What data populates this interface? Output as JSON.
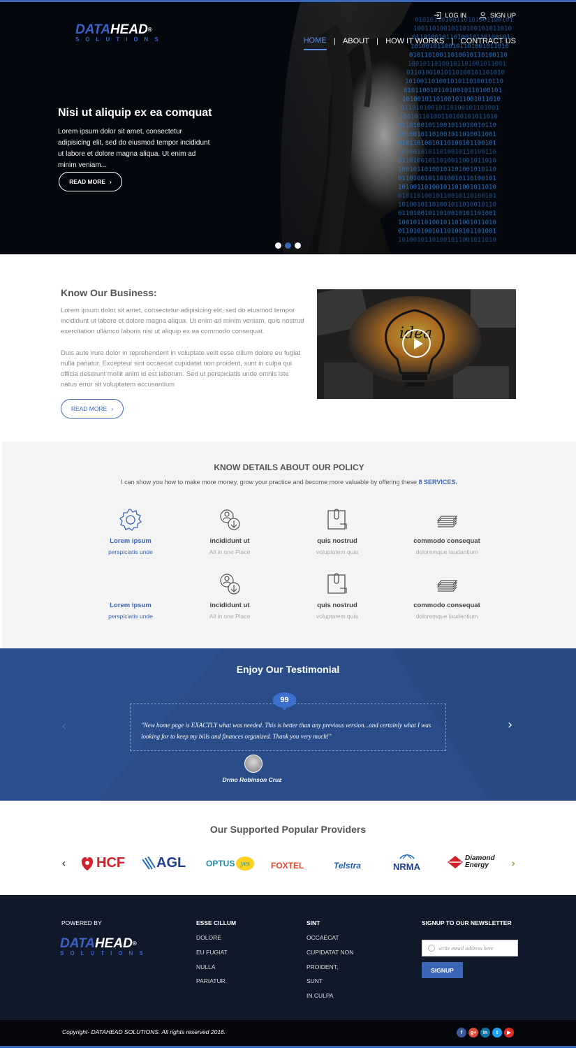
{
  "header": {
    "logo": {
      "main_a": "DATA",
      "main_b": "HEAD",
      "reg": "®",
      "sub": "SOLUTIONS"
    },
    "auth": {
      "login": "LOG IN",
      "signup": "SIGN UP"
    },
    "nav": [
      {
        "label": "HOME",
        "active": true
      },
      {
        "label": "ABOUT",
        "active": false
      },
      {
        "label": "HOW IT WORKS",
        "active": false
      },
      {
        "label": "CONTRACT US",
        "active": false
      }
    ]
  },
  "hero": {
    "title": "Nisi ut aliquip ex ea comquat",
    "text": "Lorem ipsum dolor sit amet, consectetur adipisicing elit, sed do eiusmod tempor incididunt ut labore et dolore magna aliqua. Ut enim ad minim veniam...",
    "button": "READ MORE",
    "binary_rows": [
      "01010110100110101001100101",
      "10011010010110100101011010",
      "01101001011010010110100101",
      "10100101100101101001011010",
      "01011010011010010110100110",
      "10010110100101101001011001",
      "01101001010110100101101010",
      "10100110100101011010010110",
      "01011001011010010110100101",
      "10100101101001011001011010",
      "01101010010110100101101001",
      "10010110100110100101011010",
      "01101001011001011010010110",
      "10100101101001011010011001",
      "01011010010110100101100101",
      "10100101011010010110100110",
      "01101001011010011001011010",
      "10010110100101101001010110",
      "01101001011010010110100101",
      "10100110100101101001011010",
      "01011010010110010110100101",
      "10100101101001011010010110",
      "01101001011010010101101001",
      "10010110100101101001011010",
      "01101010010110100101101001",
      "10100101101001011001011010"
    ],
    "slides": 3,
    "active_slide": 1
  },
  "business": {
    "title": "Know Our Business:",
    "p1": "Lorem ipsum dolor sit amet, consectetur adipisicing elit, sed do eiusmod tempor incididunt ut labore et dolore magna aliqua. Ut enim ad minim veniam, quis nostrud exercitation ullamco laboris nisi ut aliquip ex ea commodo consequat.",
    "p2": "Duis aute irure dolor in reprehenderit in voluptate velit esse cillum dolore eu fugiat nulla pariatur. Excepteur sint occaecat cupidatat non proident, sunt in culpa qui officia deserunt mollit anim id est laborum. Sed ut perspiciatis unde omnis iste natus error sit voluptatem accusantium",
    "button": "READ MORE",
    "video_word": "idea"
  },
  "policy": {
    "title": "KNOW DETAILS ABOUT OUR POLICY",
    "subtitle": "I can show you how to make more money, grow your practice and become more valuable by offering these",
    "subtitle_highlight": "8 SERVICES.",
    "services": [
      {
        "icon": "gear-icon",
        "title": "Lorem ipsum",
        "sub": "perspiciatis unde",
        "highlight": true
      },
      {
        "icon": "user-download-icon",
        "title": "incididunt ut",
        "sub": "All in one Place",
        "highlight": false
      },
      {
        "icon": "clipboard-icon",
        "title": "quis nostrud",
        "sub": "voluptatem quia",
        "highlight": false
      },
      {
        "icon": "stack-icon",
        "title": "commodo consequat",
        "sub": "doloremque laudantium",
        "highlight": false
      },
      {
        "icon": "",
        "title": "Lorem ipsum",
        "sub": "perspiciatis unde",
        "highlight": true
      },
      {
        "icon": "user-download-icon",
        "title": "incididunt ut",
        "sub": "All in one Place",
        "highlight": false
      },
      {
        "icon": "clipboard-icon",
        "title": "quis nostrud",
        "sub": "voluptatem quia",
        "highlight": false
      },
      {
        "icon": "stack-icon",
        "title": "commodo consequat",
        "sub": "doloremque laudantium",
        "highlight": false
      }
    ]
  },
  "testimonial": {
    "title": "Enjoy Our  Testimonial",
    "badge": "99",
    "quote": "\"New home page is EXACTLY what was needed. This is better than any previous version...and certainly what I was looking for to keep my bills and finances organized. Thank you very much!\"",
    "author": "Drmo Robinson Cruz",
    "prev": "‹",
    "next": "›"
  },
  "providers": {
    "title": "Our Supported Popular Providers",
    "prev": "‹",
    "next": "›",
    "brands": [
      {
        "name": "HCF",
        "color": "#d4202c"
      },
      {
        "name": "AGL",
        "color": "#1f3f8c"
      },
      {
        "name": "OPTUS",
        "color": "#1a8ea8",
        "extra": "yes"
      },
      {
        "name": "FOXTEL",
        "color": "#e9452a"
      },
      {
        "name": "Telstra",
        "color": "#1e5fb4"
      },
      {
        "name": "NRMA",
        "color": "#1f3f8c"
      },
      {
        "name": "Diamond",
        "color": "#1a1a1a",
        "extra": "Energy"
      }
    ]
  },
  "footer": {
    "powered": "POWERED BY",
    "col1": {
      "title": "ESSE CILLUM",
      "items": [
        "DOLORE",
        "EU FUGIAT",
        "NULLA",
        "PARIATUR."
      ]
    },
    "col2": {
      "title": "SINT",
      "items": [
        "OCCAECAT",
        "CUPIDATAT NON",
        "PROIDENT,",
        "SUNT",
        "IN CULPA"
      ]
    },
    "newsletter": {
      "title": "SIGNUP TO OUR NEWSLETTER",
      "placeholder": "write email address here",
      "button": "SIGNUP"
    },
    "copyright": "Copyright- DATAHEAD SOLUTIONS. All rights reserved 2016.",
    "socials": [
      {
        "name": "facebook-icon",
        "glyph": "f",
        "color": "#3b5998"
      },
      {
        "name": "google-plus-icon",
        "glyph": "g+",
        "color": "#dd4b39"
      },
      {
        "name": "linkedin-icon",
        "glyph": "in",
        "color": "#0e76a8"
      },
      {
        "name": "twitter-icon",
        "glyph": "t",
        "color": "#1da1f2"
      },
      {
        "name": "youtube-icon",
        "glyph": "▶",
        "color": "#e52d27"
      }
    ]
  }
}
